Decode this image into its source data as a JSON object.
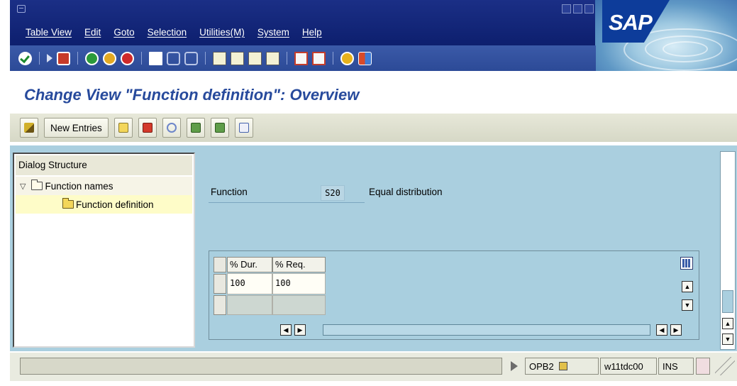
{
  "menubar": {
    "items": [
      "Table View",
      "Edit",
      "Goto",
      "Selection",
      "Utilities(M)",
      "System",
      "Help"
    ],
    "logo": "SAP"
  },
  "toolbar": {
    "icons": [
      "enter-icon",
      "command-field-icon",
      "save-icon",
      "back-icon",
      "exit-icon",
      "cancel-icon",
      "print-icon",
      "find-icon",
      "find-next-icon",
      "first-page-icon",
      "previous-page-icon",
      "next-page-icon",
      "last-page-icon",
      "create-session-icon",
      "shortcut-icon",
      "help-icon",
      "customize-layout-icon"
    ]
  },
  "page": {
    "title": "Change View \"Function definition\": Overview"
  },
  "app_toolbar": {
    "new_entries_label": "New Entries"
  },
  "dialog_structure": {
    "header": "Dialog Structure",
    "items": [
      {
        "label": "Function names",
        "expanded": true
      },
      {
        "label": "Function definition",
        "selected": true
      }
    ]
  },
  "function": {
    "label": "Function",
    "code": "S20",
    "description": "Equal distribution"
  },
  "table": {
    "columns": [
      "% Dur.",
      "% Req."
    ],
    "rows": [
      [
        "100",
        "100"
      ]
    ]
  },
  "statusbar": {
    "transaction": "OPB2",
    "server": "w11tdc00",
    "mode": "INS"
  },
  "colors": {
    "menubar": "#0d1f6e",
    "title": "#274a9c",
    "workarea": "#aacfdf"
  }
}
